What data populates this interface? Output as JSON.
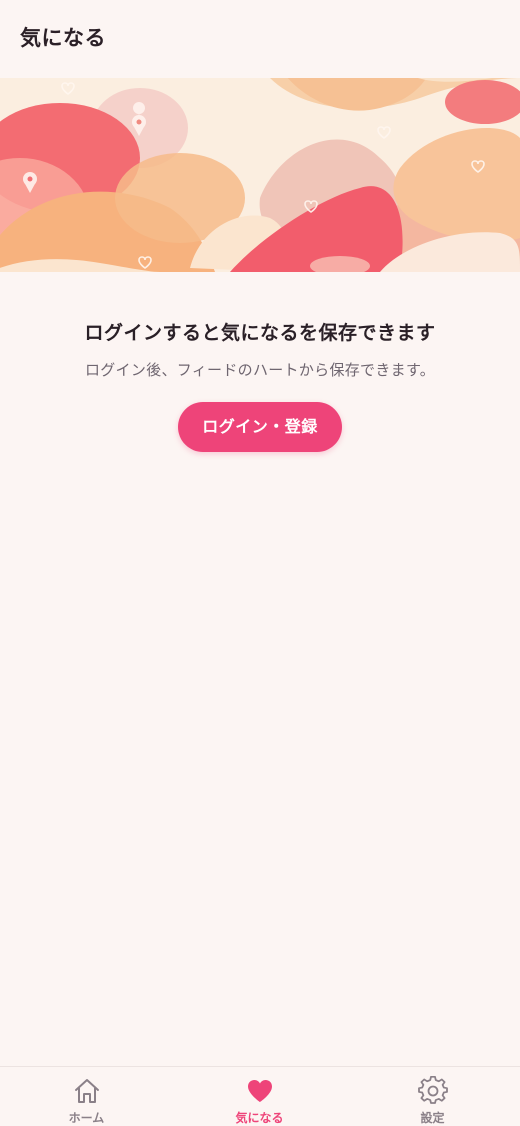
{
  "header": {
    "title": "気になる"
  },
  "empty_state": {
    "title": "ログインすると気になるを保存できます",
    "subtitle": "ログイン後、フィードのハートから保存できます。",
    "login_button_label": "ログイン・登録"
  },
  "tabbar": {
    "items": [
      {
        "label": "ホーム",
        "icon": "home-icon",
        "active": false
      },
      {
        "label": "気になる",
        "icon": "heart-icon",
        "active": true
      },
      {
        "label": "設定",
        "icon": "gear-icon",
        "active": false
      }
    ]
  },
  "colors": {
    "background": "#fcf5f3",
    "accent": "#ee4479",
    "inactive_tab": "#8a8088"
  }
}
